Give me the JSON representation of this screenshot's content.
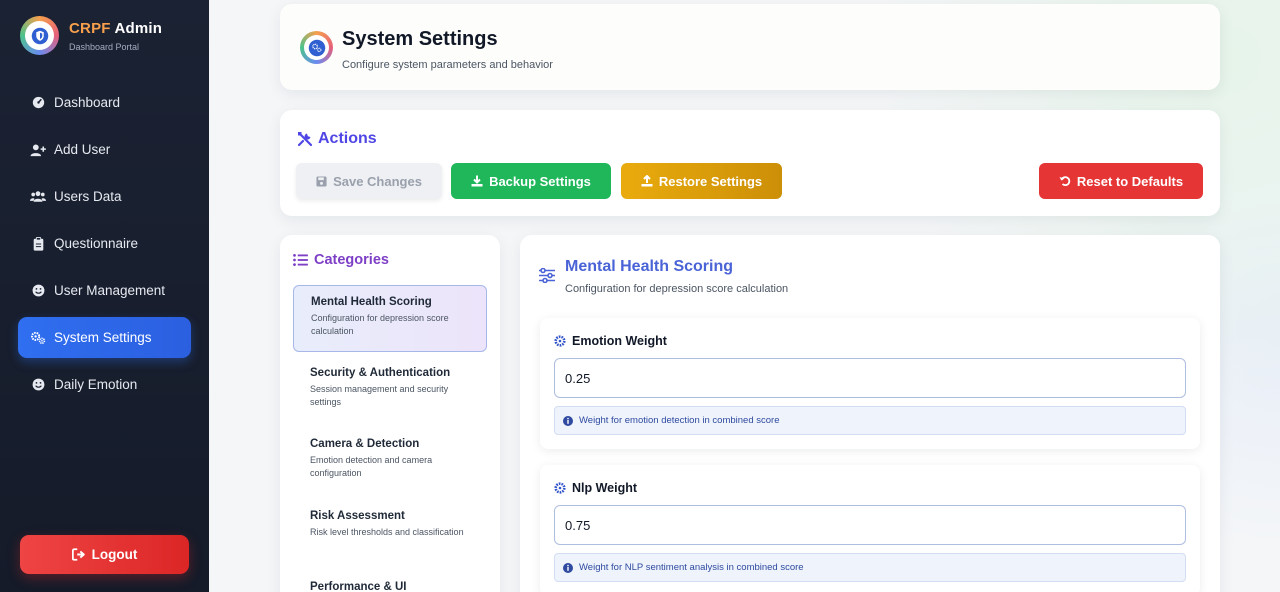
{
  "brand": {
    "title_prefix": "CRPF",
    "title_suffix": "Admin",
    "subtitle": "Dashboard Portal"
  },
  "sidebar": {
    "items": [
      {
        "label": "Dashboard",
        "icon": "gauge-icon"
      },
      {
        "label": "Add User",
        "icon": "user-plus-icon"
      },
      {
        "label": "Users Data",
        "icon": "users-icon"
      },
      {
        "label": "Questionnaire",
        "icon": "clipboard-icon"
      },
      {
        "label": "User Management",
        "icon": "smile-icon"
      },
      {
        "label": "System Settings",
        "icon": "gears-icon",
        "active": true
      },
      {
        "label": "Daily Emotion",
        "icon": "smile-icon"
      }
    ],
    "logout_label": "Logout"
  },
  "header": {
    "title": "System Settings",
    "subtitle": "Configure system parameters and behavior"
  },
  "actions": {
    "title": "Actions",
    "save_label": "Save Changes",
    "backup_label": "Backup Settings",
    "restore_label": "Restore Settings",
    "reset_label": "Reset to Defaults"
  },
  "categories": {
    "title": "Categories",
    "items": [
      {
        "name": "Mental Health Scoring",
        "desc": "Configuration for depression score calculation",
        "active": true
      },
      {
        "name": "Security & Authentication",
        "desc": "Session management and security settings"
      },
      {
        "name": "Camera & Detection",
        "desc": "Emotion detection and camera configuration"
      },
      {
        "name": "Risk Assessment",
        "desc": "Risk level thresholds and classification"
      },
      {
        "name": "Performance & UI",
        "desc": ""
      }
    ]
  },
  "panel": {
    "title": "Mental Health Scoring",
    "subtitle": "Configuration for depression score calculation",
    "fields": [
      {
        "label": "Emotion Weight",
        "value": "0.25",
        "hint": "Weight for emotion detection in combined score"
      },
      {
        "label": "Nlp Weight",
        "value": "0.75",
        "hint": "Weight for NLP sentiment analysis in combined score"
      }
    ]
  },
  "colors": {
    "active_nav": "#2f6ff0",
    "backup": "#1fb75a",
    "restore": "#e9ab0c",
    "reset": "#e53535",
    "logout": "#ef4444"
  }
}
